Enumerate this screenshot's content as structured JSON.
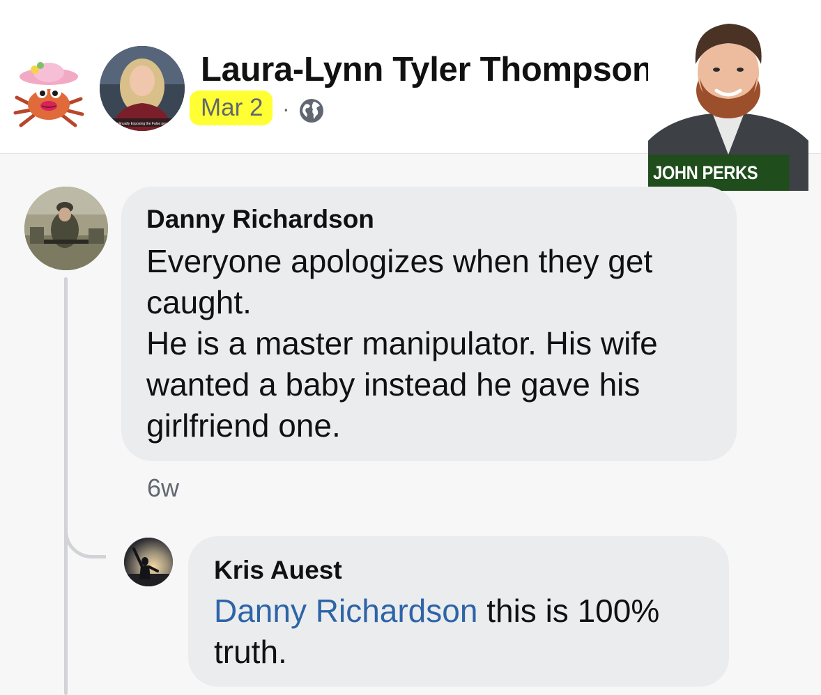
{
  "post": {
    "author_name": "Laura-Lynn Tyler Thompson",
    "date": "Mar 2",
    "separator": "·",
    "privacy_icon": "globe-icon",
    "avatar_caption": "Continually Exposing the False people"
  },
  "overlay": {
    "label": "JOHN PERKS"
  },
  "comments": [
    {
      "author": "Danny Richardson",
      "lines": [
        "Everyone apologizes when they get",
        "caught.",
        "He is a master manipulator. His wife",
        "wanted a baby instead he gave his",
        "girlfriend one."
      ],
      "timestamp": "6w"
    }
  ],
  "reply": {
    "author": "Kris Auest",
    "mention": "Danny Richardson",
    "text": " this is 100% truth."
  },
  "colors": {
    "date_highlight": "#ffff33",
    "mention_link": "#2d64a8",
    "bubble_bg": "#ebecee",
    "meta_text": "#606770"
  }
}
